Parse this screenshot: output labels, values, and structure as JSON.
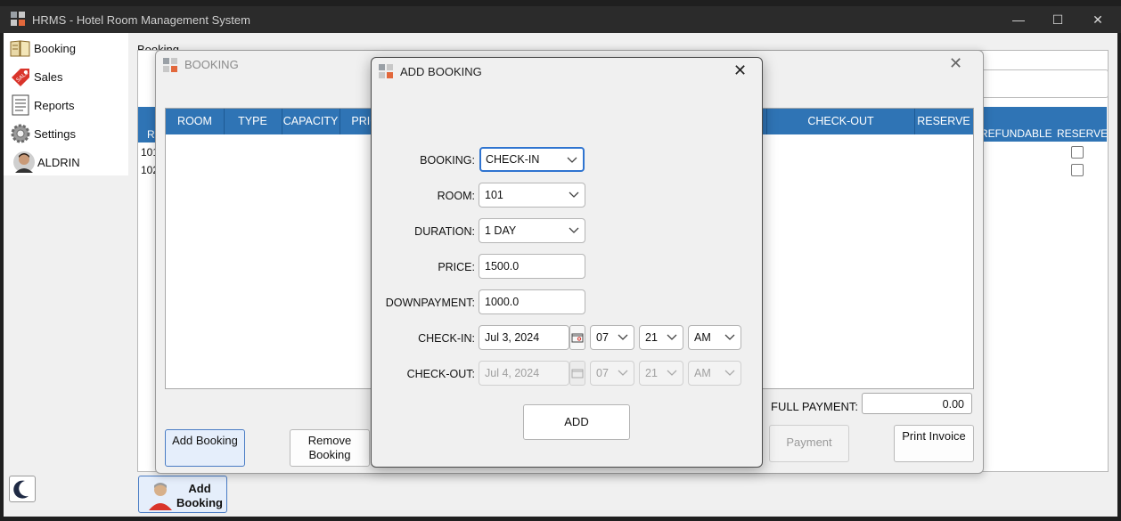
{
  "window": {
    "title": "HRMS - Hotel Room Management System",
    "minimize": "—",
    "maximize": "☐",
    "close": "✕"
  },
  "sidebar": {
    "items": [
      {
        "label": "Booking",
        "icon": "book-icon"
      },
      {
        "label": "Sales",
        "icon": "sale-tag-icon"
      },
      {
        "label": "Reports",
        "icon": "document-icon"
      },
      {
        "label": "Settings",
        "icon": "gear-icon"
      },
      {
        "label": "ALDRIN",
        "icon": "avatar-icon"
      }
    ]
  },
  "background": {
    "breadcrumb": "Booking",
    "right_headers": [
      "REFUNDABLE",
      "RESERVE"
    ],
    "row_ids": [
      "101",
      "102"
    ],
    "left_header_fragment": "R",
    "add_booking_label": "Add Booking"
  },
  "booking_window": {
    "title": "BOOKING",
    "close": "✕",
    "columns": [
      "ROOM",
      "TYPE",
      "CAPACITY",
      "PRICE",
      "CHECK-OUT",
      "RESERVE"
    ],
    "full_payment_label": "FULL PAYMENT:",
    "full_payment_value": "0.00",
    "buttons": {
      "add": "Add Booking",
      "remove": "Remove Booking",
      "payment": "Payment",
      "print": "Print Invoice"
    }
  },
  "dialog": {
    "title": "ADD BOOKING",
    "close": "✕",
    "fields": {
      "booking": {
        "label": "BOOKING:",
        "value": "CHECK-IN"
      },
      "room": {
        "label": "ROOM:",
        "value": "101"
      },
      "duration": {
        "label": "DURATION:",
        "value": "1 DAY"
      },
      "price": {
        "label": "PRICE:",
        "value": "1500.0"
      },
      "downpayment": {
        "label": "DOWNPAYMENT:",
        "value": "1000.0"
      },
      "checkin": {
        "label": "CHECK-IN:",
        "date": "Jul 3, 2024",
        "hour": "07",
        "minute": "21",
        "ampm": "AM"
      },
      "checkout": {
        "label": "CHECK-OUT:",
        "date": "Jul 4, 2024",
        "hour": "07",
        "minute": "21",
        "ampm": "AM"
      }
    },
    "add_button": "ADD"
  },
  "colors": {
    "header_blue": "#2f74b5",
    "focus_blue": "#2f74d0",
    "titlebar": "#2b2b2b"
  }
}
